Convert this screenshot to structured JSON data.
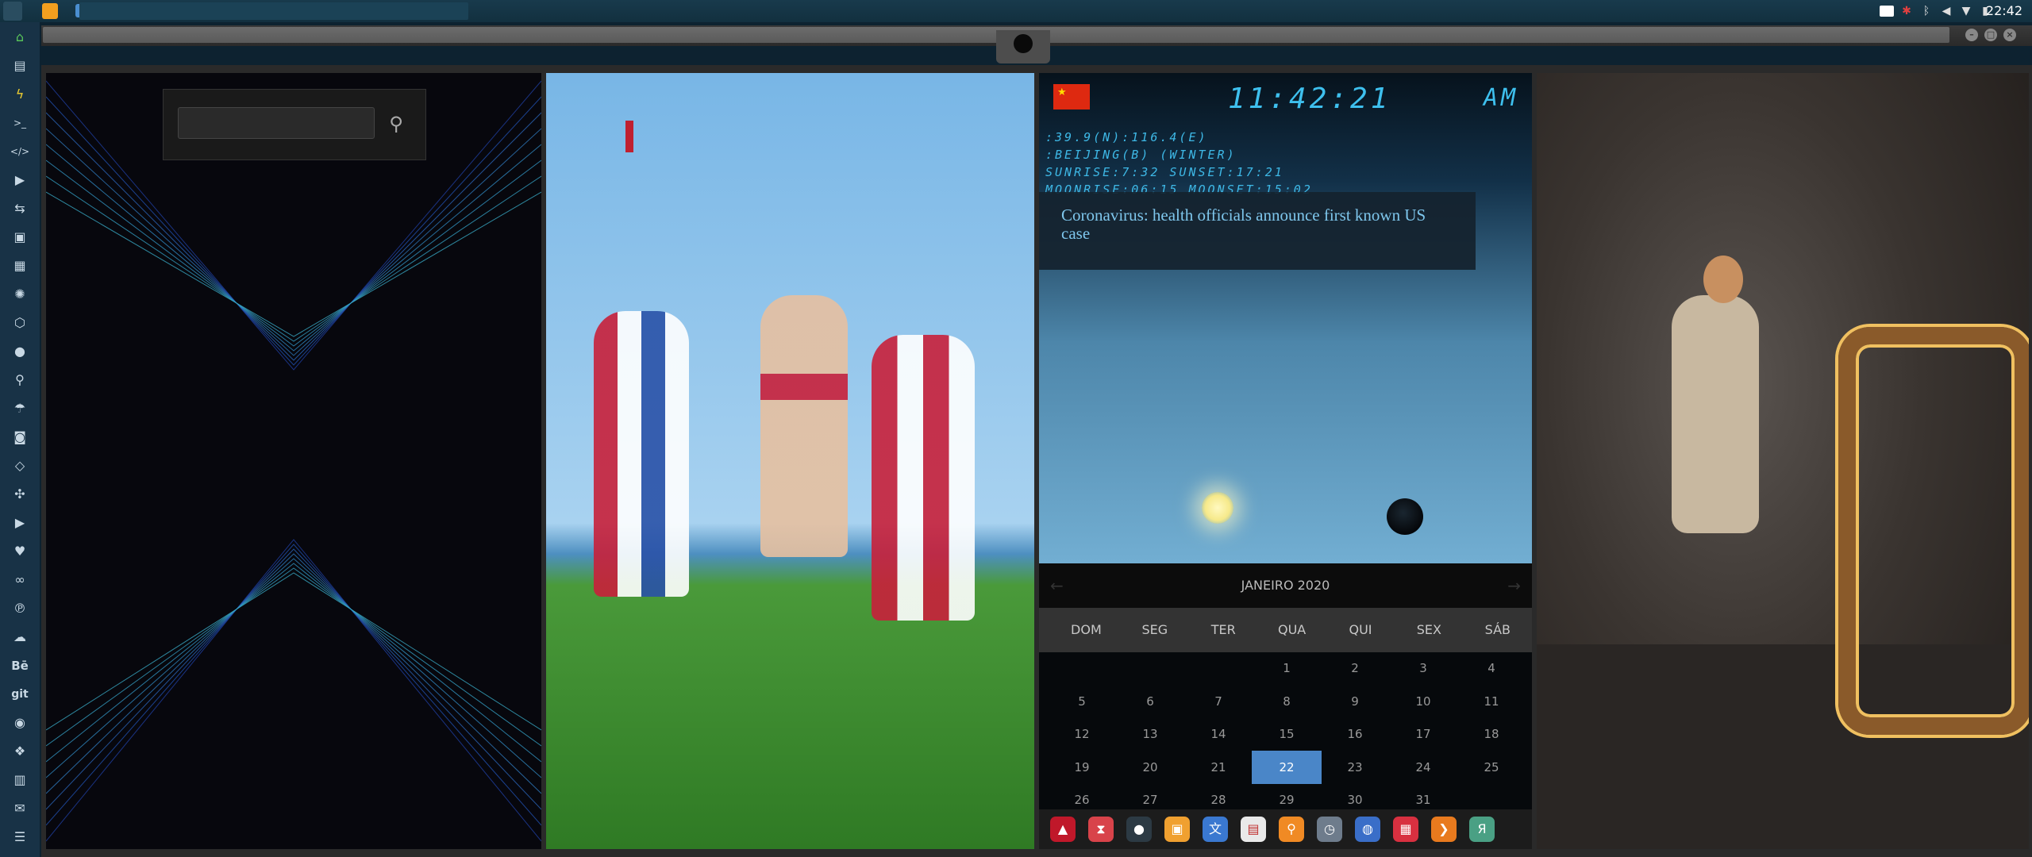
{
  "taskbar": {
    "clock": "22:42",
    "tray_icons": [
      "image-icon",
      "alert-icon",
      "bluetooth-icon",
      "volume-icon",
      "wifi-icon",
      "power-icon"
    ]
  },
  "sidebar": {
    "items": [
      "home-icon",
      "document-icon",
      "bolt-icon",
      "terminal-icon",
      "code-icon",
      "play-icon",
      "translate-icon",
      "image-icon",
      "news-icon",
      "aperture-icon",
      "hexagon-icon",
      "globe-icon",
      "search-icon",
      "umbrella-icon",
      "contact-icon",
      "tag-icon",
      "expand-icon",
      "youtube-icon",
      "heart-icon",
      "cloud-link-icon",
      "pinterest-icon",
      "cloud-icon",
      "behance-icon",
      "git-icon",
      "github-icon",
      "dropbox-icon",
      "map-icon",
      "mail-icon",
      "list-icon"
    ],
    "labels": {
      "behance": "Bē",
      "git": "git",
      "terminal": ">_",
      "code": "</>"
    }
  },
  "search": {
    "placeholder": "",
    "value": ""
  },
  "weather": {
    "time": "11:42:21",
    "ampm": "AM",
    "line1": ":39.9(N):116.4(E)",
    "line2": ":BEIJING(B) (WINTER)",
    "line3": "SUNRISE:7:32 SUNSET:17:21",
    "line4": "MOONRISE:06:15 MOONSET:15:02",
    "news": "Coronavirus: health officials announce first known US case",
    "flag_color": "#de2910"
  },
  "calendar": {
    "title": "JANEIRO 2020",
    "prev": "←",
    "next": "→",
    "daynames": [
      "DOM",
      "SEG",
      "TER",
      "QUA",
      "QUI",
      "SEX",
      "SÁB"
    ],
    "weeks": [
      [
        "",
        "",
        "",
        "1",
        "2",
        "3",
        "4"
      ],
      [
        "5",
        "6",
        "7",
        "8",
        "9",
        "10",
        "11"
      ],
      [
        "12",
        "13",
        "14",
        "15",
        "16",
        "17",
        "18"
      ],
      [
        "19",
        "20",
        "21",
        "22",
        "23",
        "24",
        "25"
      ],
      [
        "26",
        "27",
        "28",
        "29",
        "30",
        "31",
        ""
      ]
    ],
    "selected": "22",
    "accent": "#4a86c8"
  },
  "dock": {
    "items": [
      {
        "icon": "triangle-app-icon",
        "color": "#c0182a"
      },
      {
        "icon": "hourglass-icon",
        "color": "#d8434a"
      },
      {
        "icon": "ball-icon",
        "color": "#2c3a44"
      },
      {
        "icon": "photos-icon",
        "color": "#f0a030"
      },
      {
        "icon": "translate-app-icon",
        "color": "#3a78d0"
      },
      {
        "icon": "notes-icon",
        "color": "#e9e9e9"
      },
      {
        "icon": "search-app-icon",
        "color": "#f08a24"
      },
      {
        "icon": "clock-app-icon",
        "color": "#6e7c8c"
      },
      {
        "icon": "globe-app-icon",
        "color": "#3a6ec8"
      },
      {
        "icon": "calendar-app-icon",
        "color": "#d83040"
      },
      {
        "icon": "arrow-app-icon",
        "color": "#e87a1e"
      },
      {
        "icon": "yandex-icon",
        "color": "#4aa084"
      }
    ]
  }
}
